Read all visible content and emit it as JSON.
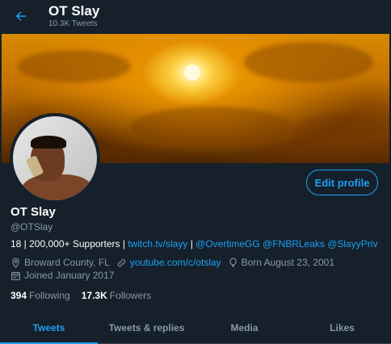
{
  "header": {
    "title": "OT Slay",
    "tweet_count": "10.3K Tweets"
  },
  "profile": {
    "name": "OT Slay",
    "handle": "@OTSlay",
    "edit_label": "Edit profile",
    "bio": {
      "plain": "18 | 200,000+ Supporters | ",
      "link1": "twitch.tv/slayy",
      "sep": " | ",
      "mention1": "@OvertimeGG",
      "mention2": "@FNBRLeaks",
      "mention3": "@SlayyPriv"
    },
    "location": "Broward County, FL",
    "website": "youtube.com/c/otslay",
    "birthday": "Born August 23, 2001",
    "joined": "Joined January 2017",
    "following_count": "394",
    "following_label": "Following",
    "followers_count": "17.3K",
    "followers_label": "Followers"
  },
  "tabs": [
    {
      "label": "Tweets"
    },
    {
      "label": "Tweets & replies"
    },
    {
      "label": "Media"
    },
    {
      "label": "Likes"
    }
  ],
  "colors": {
    "background": "#15202b",
    "accent": "#1da1f2",
    "muted": "#8899a6"
  }
}
